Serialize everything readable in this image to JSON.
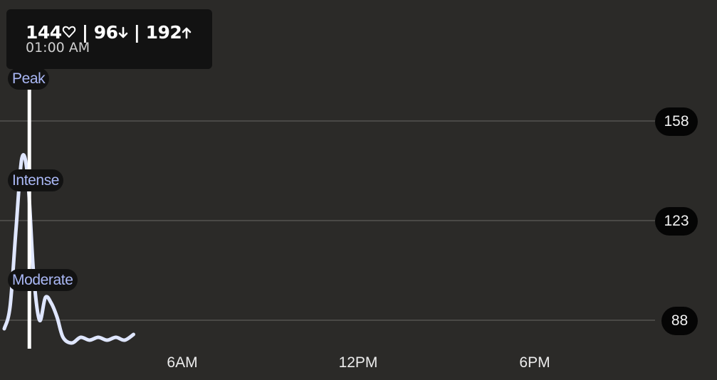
{
  "tooltip": {
    "heart_rate": "144",
    "heart_icon": "heart-outline-icon",
    "min_value": "96",
    "min_icon": "arrow-down-icon",
    "max_value": "192",
    "max_icon": "arrow-up-icon",
    "separator": "|",
    "time": "01:00 AM"
  },
  "zones": [
    "Peak",
    "Intense",
    "Moderate"
  ],
  "colors": {
    "background": "#2b2a28",
    "line": "#dfe6ff",
    "zone_text": "#aab8f6",
    "cursor": "#ffffff",
    "gridline": "#4a4946"
  },
  "chart_data": {
    "type": "line",
    "x_tick_labels": [
      "6AM",
      "12PM",
      "6PM"
    ],
    "y_tick_labels": [
      "158",
      "123",
      "88"
    ],
    "y_ticks": [
      158,
      123,
      88
    ],
    "xlim_hours": [
      0,
      24
    ],
    "grid": true,
    "series": [
      {
        "x_hours": [
          0.0,
          0.2,
          0.4,
          0.6,
          0.8,
          1.0,
          1.2,
          1.4,
          1.6,
          1.8,
          2.0,
          2.3,
          2.6,
          2.9,
          3.2,
          3.5,
          3.8,
          4.1,
          4.4
        ],
        "values": [
          85,
          93,
          120,
          145,
          138,
          104,
          88,
          96,
          94,
          89,
          82,
          80,
          82,
          81,
          82,
          81,
          82,
          81,
          83
        ]
      }
    ],
    "cursor_hour": 1.0
  }
}
